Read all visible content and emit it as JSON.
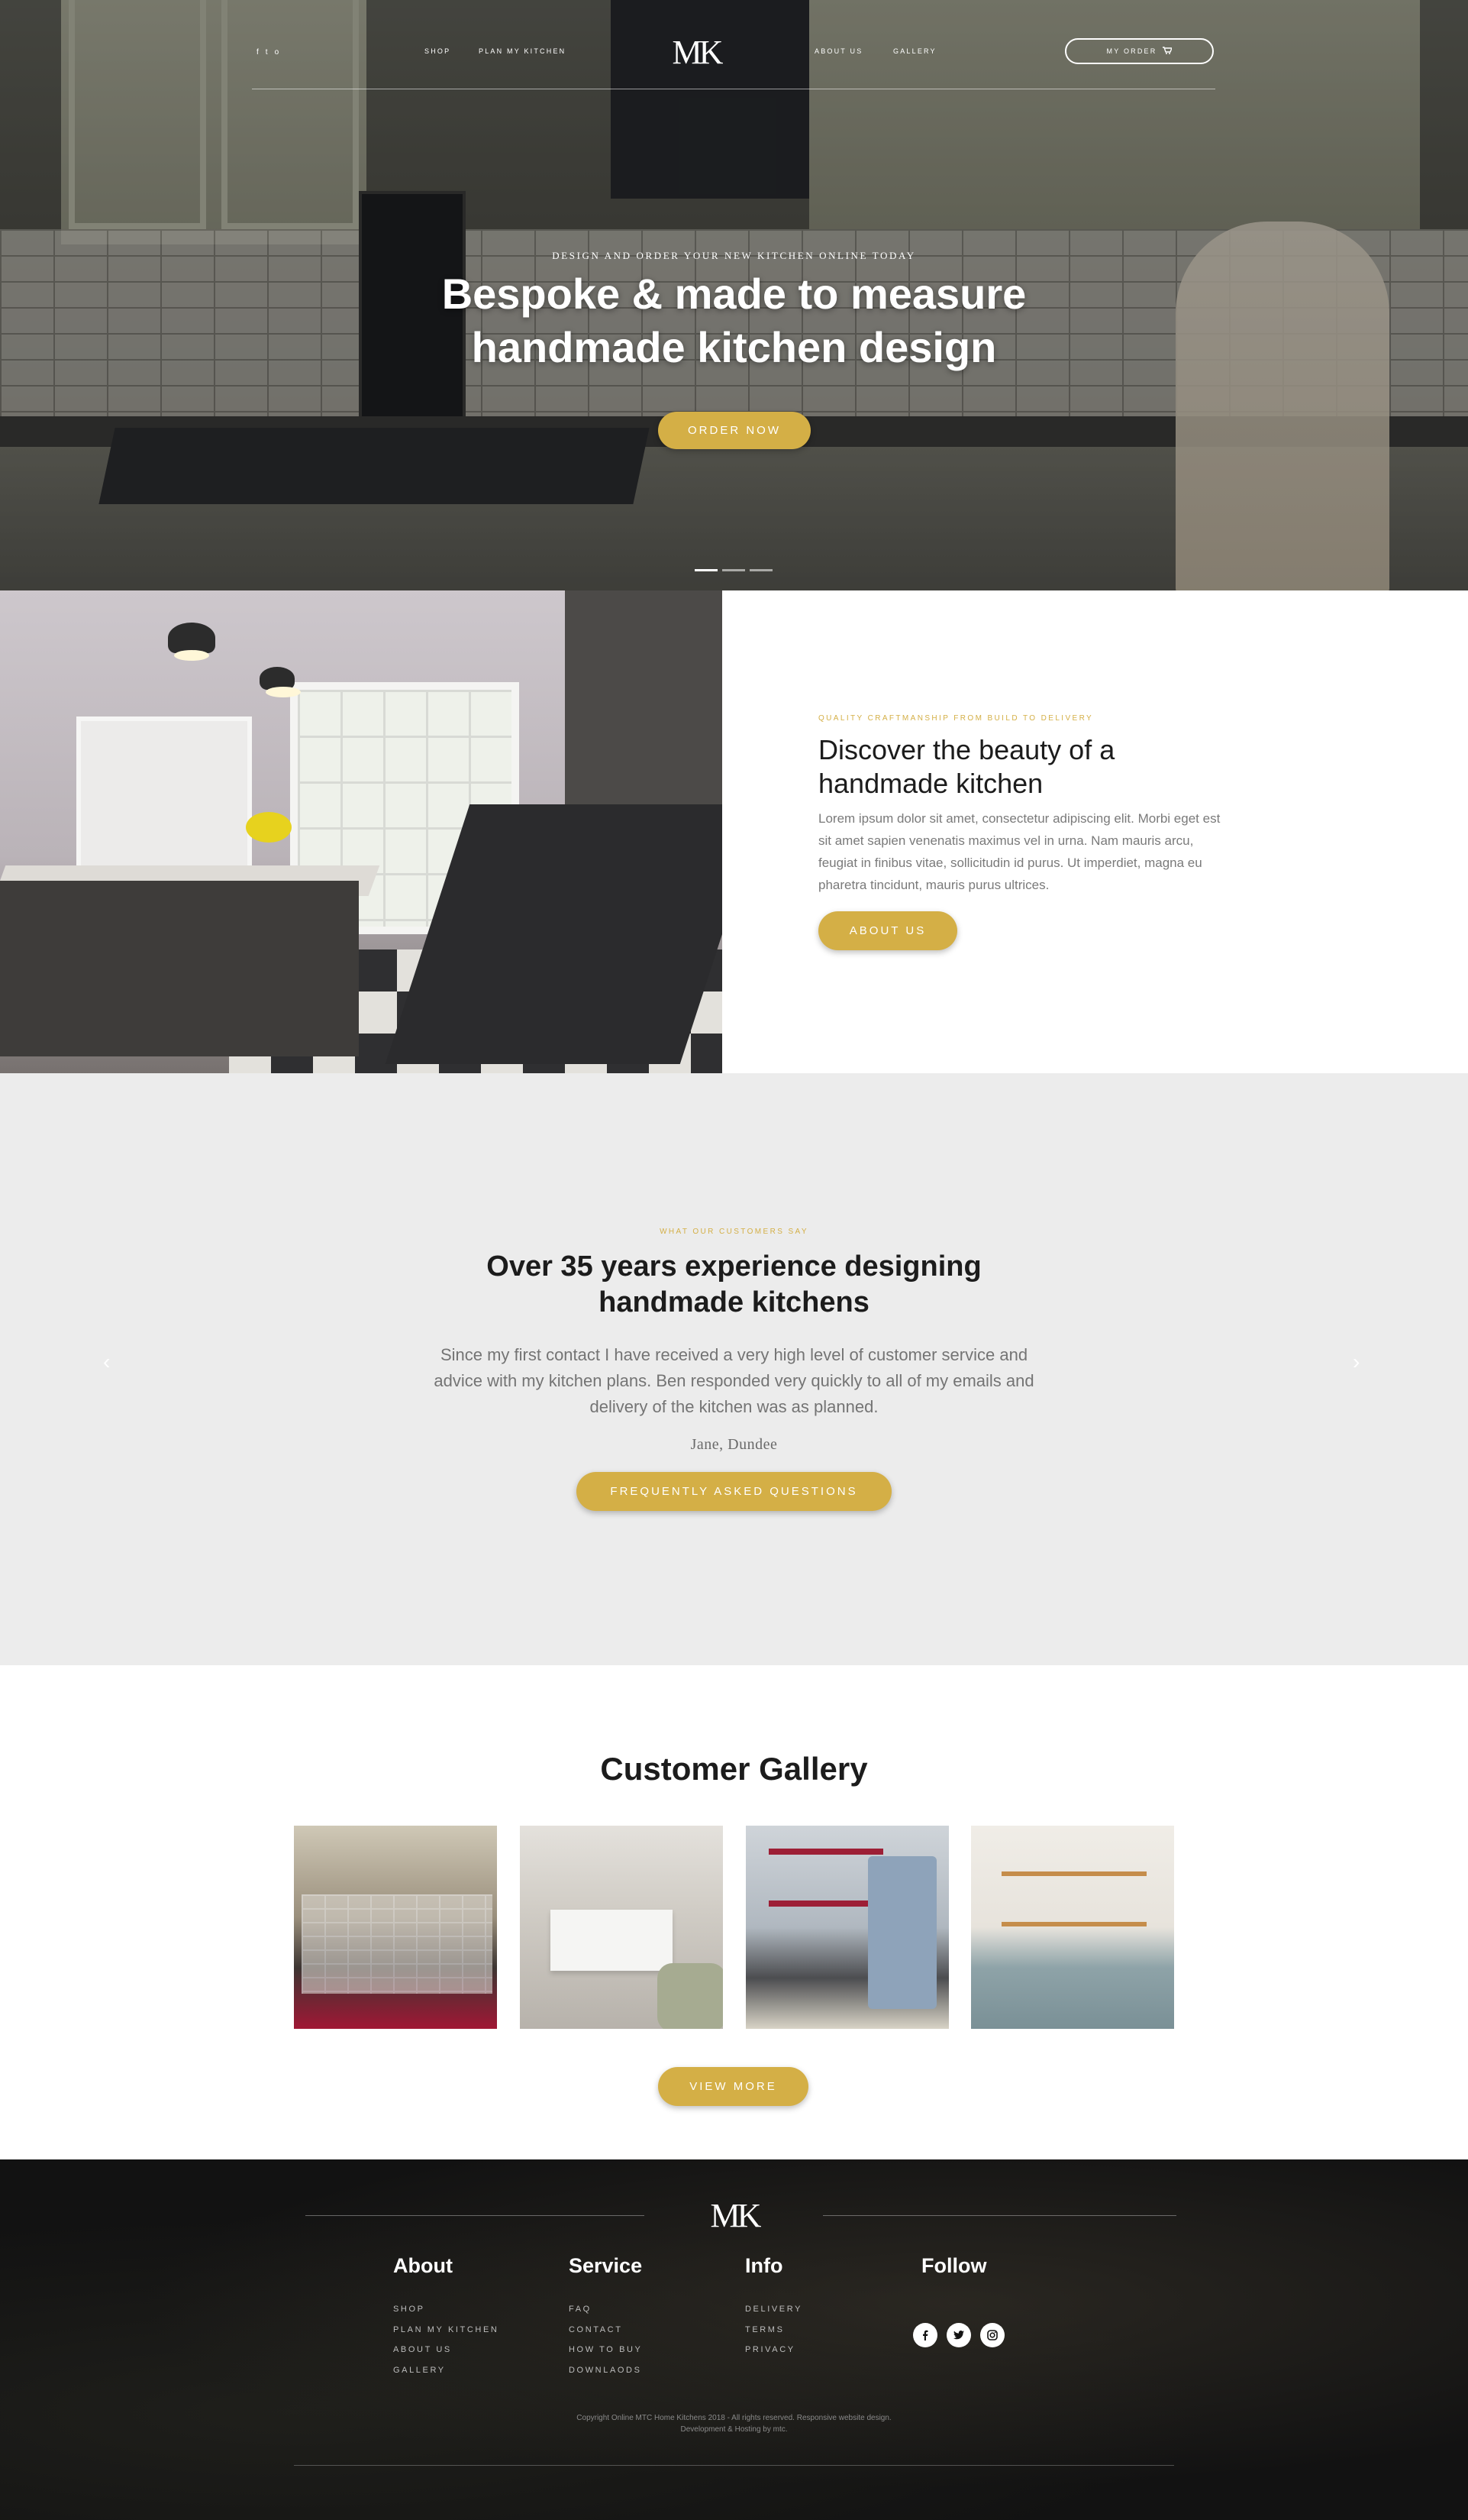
{
  "hero": {
    "social": [
      "f",
      "t",
      "o"
    ],
    "nav_left": [
      "SHOP",
      "PLAN MY KITCHEN"
    ],
    "nav_right": [
      "ABOUT US",
      "GALLERY"
    ],
    "logo": "MK",
    "order_label": "MY ORDER",
    "kicker": "DESIGN AND ORDER YOUR NEW KITCHEN ONLINE TODAY",
    "title": "Bespoke & made to measure handmade kitchen design",
    "button": "ORDER NOW",
    "slides_total": 3,
    "active_slide": 1
  },
  "discover": {
    "kicker": "QUALITY CRAFTMANSHIP FROM BUILD TO DELIVERY",
    "title": "Discover the beauty of a handmade kitchen",
    "body": "Lorem ipsum dolor sit amet, consectetur adipiscing elit. Morbi eget est sit amet sapien venenatis maximus vel in urna. Nam mauris arcu, feugiat in finibus vitae, sollicitudin id purus. Ut imperdiet, magna eu pharetra tincidunt, mauris purus ultrices.",
    "button": "ABOUT US"
  },
  "testimonial": {
    "kicker": "WHAT OUR CUSTOMERS SAY",
    "title": "Over 35 years experience designing handmade kitchens",
    "quote": "Since my first contact I have received a very high level of customer service and advice with my kitchen plans. Ben responded very quickly to all of my emails and delivery of the kitchen was as planned.",
    "author": "Jane, Dundee",
    "button": "FREQUENTLY ASKED QUESTIONS",
    "prev_arrow": "‹",
    "next_arrow": "›"
  },
  "gallery": {
    "title": "Customer Gallery",
    "button": "VIEW MORE"
  },
  "footer": {
    "logo": "MK",
    "columns": [
      {
        "title": "About",
        "links": [
          "SHOP",
          "PLAN MY KITCHEN",
          "ABOUT US",
          "GALLERY"
        ]
      },
      {
        "title": "Service",
        "links": [
          "FAQ",
          "CONTACT",
          "HOW TO BUY",
          "DOWNLAODS"
        ]
      },
      {
        "title": "Info",
        "links": [
          "DELIVERY",
          "TERMS",
          "PRIVACY"
        ]
      },
      {
        "title": "Follow",
        "links": []
      }
    ],
    "follow_icons": [
      "facebook-icon",
      "twitter-icon",
      "instagram-icon"
    ],
    "copyright_line1": "Copyright Online MTC Home Kitchens 2018 - All rights reserved. Responsive website design.",
    "copyright_line2": "Development & Hosting by mtc."
  },
  "colors": {
    "accent": "#d4af46",
    "testimonial_bg": "#ececec",
    "footer_bg": "#121212"
  }
}
